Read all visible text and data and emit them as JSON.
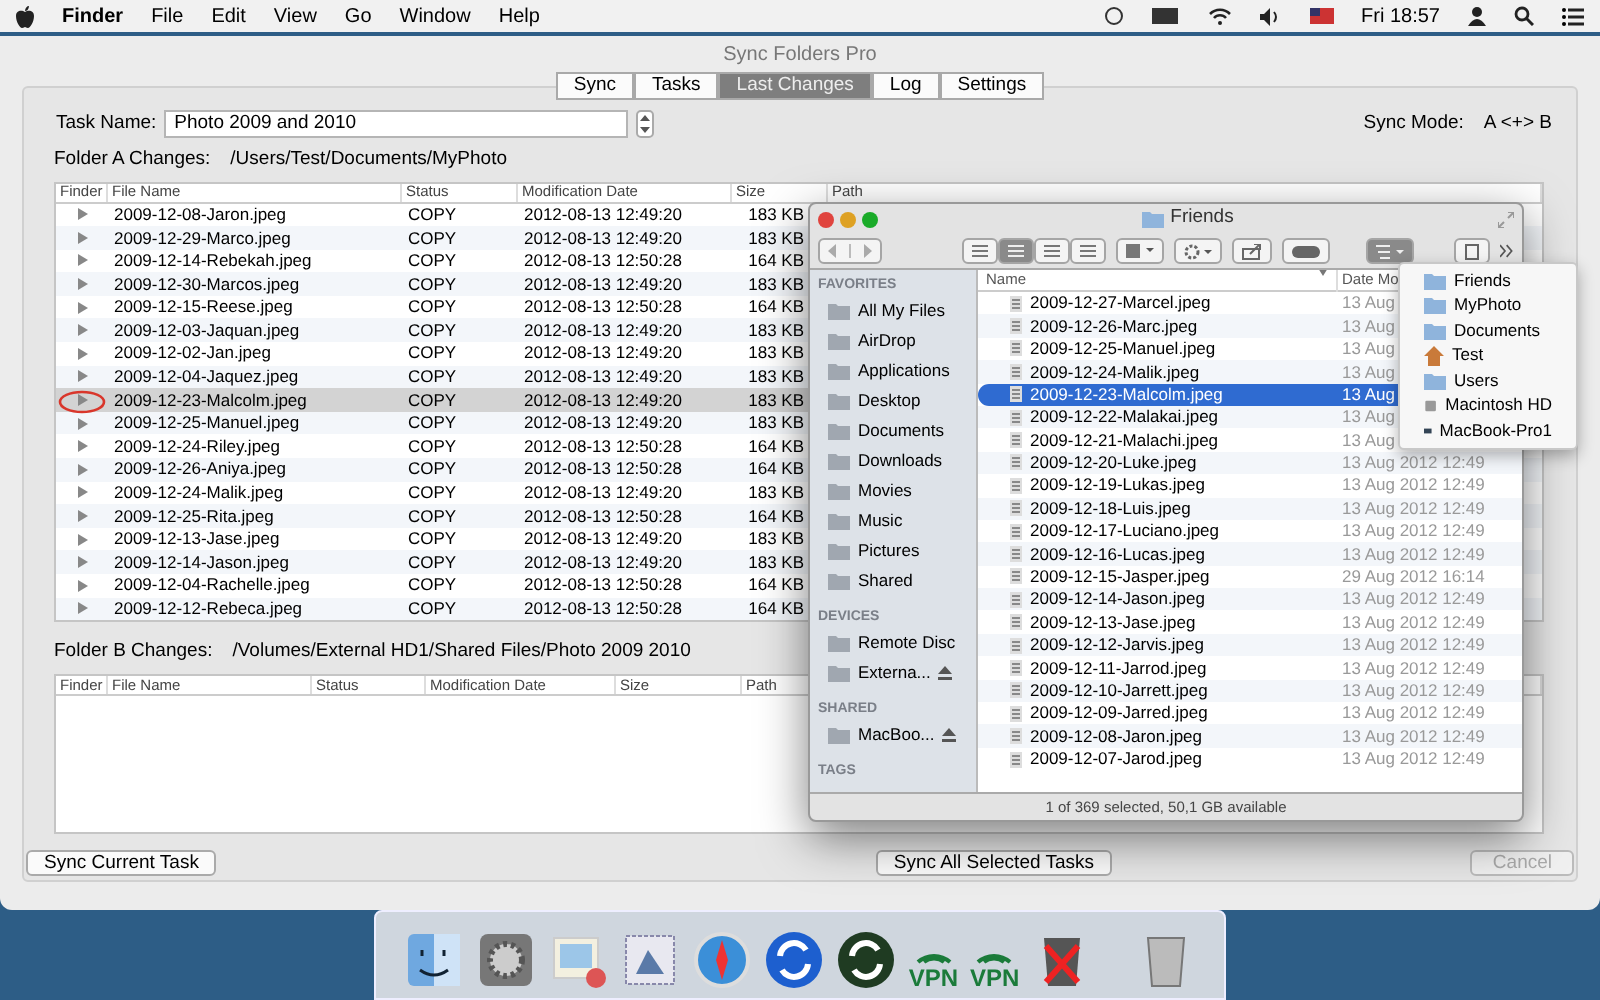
{
  "menu_bar": {
    "app": "Finder",
    "menus": [
      "File",
      "Edit",
      "View",
      "Go",
      "Window",
      "Help"
    ],
    "clock": "Fri 18:57"
  },
  "window": {
    "title": "Sync Folders Pro",
    "tabs": [
      {
        "label": "Sync",
        "selected": false
      },
      {
        "label": "Tasks",
        "selected": false
      },
      {
        "label": "Last Changes",
        "selected": true
      },
      {
        "label": "Log",
        "selected": false
      },
      {
        "label": "Settings",
        "selected": false
      }
    ],
    "task_name": {
      "label": "Task Name:",
      "value": "Photo 2009 and 2010"
    },
    "sync_mode": {
      "label": "Sync Mode:",
      "value": "A <+> B"
    },
    "folder_a": {
      "label": "Folder A Changes:",
      "path": "/Users/Test/Documents/MyPhoto",
      "columns": [
        "Finder",
        "File Name",
        "Status",
        "Modification Date",
        "Size",
        "Path"
      ],
      "rows": [
        {
          "name": "2009-12-08-Jaron.jpeg",
          "status": "COPY",
          "date": "2012-08-13 12:49:20",
          "size": "183 KB",
          "selected": false
        },
        {
          "name": "2009-12-29-Marco.jpeg",
          "status": "COPY",
          "date": "2012-08-13 12:49:20",
          "size": "183 KB",
          "selected": false
        },
        {
          "name": "2009-12-14-Rebekah.jpeg",
          "status": "COPY",
          "date": "2012-08-13 12:50:28",
          "size": "164 KB",
          "selected": false
        },
        {
          "name": "2009-12-30-Marcos.jpeg",
          "status": "COPY",
          "date": "2012-08-13 12:49:20",
          "size": "183 KB",
          "selected": false
        },
        {
          "name": "2009-12-15-Reese.jpeg",
          "status": "COPY",
          "date": "2012-08-13 12:50:28",
          "size": "164 KB",
          "selected": false
        },
        {
          "name": "2009-12-03-Jaquan.jpeg",
          "status": "COPY",
          "date": "2012-08-13 12:49:20",
          "size": "183 KB",
          "selected": false
        },
        {
          "name": "2009-12-02-Jan.jpeg",
          "status": "COPY",
          "date": "2012-08-13 12:49:20",
          "size": "183 KB",
          "selected": false
        },
        {
          "name": "2009-12-04-Jaquez.jpeg",
          "status": "COPY",
          "date": "2012-08-13 12:49:20",
          "size": "183 KB",
          "selected": false
        },
        {
          "name": "2009-12-23-Malcolm.jpeg",
          "status": "COPY",
          "date": "2012-08-13 12:49:20",
          "size": "183 KB",
          "selected": true
        },
        {
          "name": "2009-12-25-Manuel.jpeg",
          "status": "COPY",
          "date": "2012-08-13 12:49:20",
          "size": "183 KB",
          "selected": false
        },
        {
          "name": "2009-12-24-Riley.jpeg",
          "status": "COPY",
          "date": "2012-08-13 12:50:28",
          "size": "164 KB",
          "selected": false
        },
        {
          "name": "2009-12-26-Aniya.jpeg",
          "status": "COPY",
          "date": "2012-08-13 12:50:28",
          "size": "164 KB",
          "selected": false
        },
        {
          "name": "2009-12-24-Malik.jpeg",
          "status": "COPY",
          "date": "2012-08-13 12:49:20",
          "size": "183 KB",
          "selected": false
        },
        {
          "name": "2009-12-25-Rita.jpeg",
          "status": "COPY",
          "date": "2012-08-13 12:50:28",
          "size": "164 KB",
          "selected": false
        },
        {
          "name": "2009-12-13-Jase.jpeg",
          "status": "COPY",
          "date": "2012-08-13 12:49:20",
          "size": "183 KB",
          "selected": false
        },
        {
          "name": "2009-12-14-Jason.jpeg",
          "status": "COPY",
          "date": "2012-08-13 12:49:20",
          "size": "183 KB",
          "selected": false
        },
        {
          "name": "2009-12-04-Rachelle.jpeg",
          "status": "COPY",
          "date": "2012-08-13 12:50:28",
          "size": "164 KB",
          "selected": false
        },
        {
          "name": "2009-12-12-Rebeca.jpeg",
          "status": "COPY",
          "date": "2012-08-13 12:50:28",
          "size": "164 KB",
          "selected": false
        }
      ]
    },
    "folder_b": {
      "label": "Folder B Changes:",
      "path": "/Volumes/External HD1/Shared Files/Photo 2009 2010",
      "columns": [
        "Finder",
        "File Name",
        "Status",
        "Modification Date",
        "Size",
        "Path"
      ]
    },
    "buttons": {
      "sync_current": "Sync Current Task",
      "sync_all": "Sync All Selected Tasks",
      "cancel": {
        "label": "Cancel",
        "disabled": true
      }
    }
  },
  "finder": {
    "title": "Friends",
    "sidebar": [
      {
        "heading": "FAVORITES",
        "items": [
          {
            "label": "All My Files",
            "eject": false
          },
          {
            "label": "AirDrop",
            "eject": false
          },
          {
            "label": "Applications",
            "eject": false
          },
          {
            "label": "Desktop",
            "eject": false
          },
          {
            "label": "Documents",
            "eject": false
          },
          {
            "label": "Downloads",
            "eject": false
          },
          {
            "label": "Movies",
            "eject": false
          },
          {
            "label": "Music",
            "eject": false
          },
          {
            "label": "Pictures",
            "eject": false
          },
          {
            "label": "Shared",
            "eject": false
          }
        ]
      },
      {
        "heading": "DEVICES",
        "items": [
          {
            "label": "Remote Disc",
            "eject": false
          },
          {
            "label": "Externa...",
            "eject": true
          }
        ]
      },
      {
        "heading": "SHARED",
        "items": [
          {
            "label": "MacBoo...",
            "eject": true
          }
        ]
      },
      {
        "heading": "TAGS"
      }
    ],
    "columns": [
      "Name",
      "Date Mo"
    ],
    "files": [
      {
        "name": "2009-12-27-Marcel.jpeg",
        "date": "13 Aug",
        "selected": false
      },
      {
        "name": "2009-12-26-Marc.jpeg",
        "date": "13 Aug",
        "selected": false
      },
      {
        "name": "2009-12-25-Manuel.jpeg",
        "date": "13 Aug",
        "selected": false
      },
      {
        "name": "2009-12-24-Malik.jpeg",
        "date": "13 Aug",
        "selected": false
      },
      {
        "name": "2009-12-23-Malcolm.jpeg",
        "date": "13 Aug",
        "selected": true
      },
      {
        "name": "2009-12-22-Malakai.jpeg",
        "date": "13 Aug",
        "selected": false
      },
      {
        "name": "2009-12-21-Malachi.jpeg",
        "date": "13 Aug",
        "selected": false
      },
      {
        "name": "2009-12-20-Luke.jpeg",
        "date": "13 Aug 2012 12:49",
        "selected": false
      },
      {
        "name": "2009-12-19-Lukas.jpeg",
        "date": "13 Aug 2012 12:49",
        "selected": false
      },
      {
        "name": "2009-12-18-Luis.jpeg",
        "date": "13 Aug 2012 12:49",
        "selected": false
      },
      {
        "name": "2009-12-17-Luciano.jpeg",
        "date": "13 Aug 2012 12:49",
        "selected": false
      },
      {
        "name": "2009-12-16-Lucas.jpeg",
        "date": "13 Aug 2012 12:49",
        "selected": false
      },
      {
        "name": "2009-12-15-Jasper.jpeg",
        "date": "29 Aug 2012 16:14",
        "selected": false
      },
      {
        "name": "2009-12-14-Jason.jpeg",
        "date": "13 Aug 2012 12:49",
        "selected": false
      },
      {
        "name": "2009-12-13-Jase.jpeg",
        "date": "13 Aug 2012 12:49",
        "selected": false
      },
      {
        "name": "2009-12-12-Jarvis.jpeg",
        "date": "13 Aug 2012 12:49",
        "selected": false
      },
      {
        "name": "2009-12-11-Jarrod.jpeg",
        "date": "13 Aug 2012 12:49",
        "selected": false
      },
      {
        "name": "2009-12-10-Jarrett.jpeg",
        "date": "13 Aug 2012 12:49",
        "selected": false
      },
      {
        "name": "2009-12-09-Jarred.jpeg",
        "date": "13 Aug 2012 12:49",
        "selected": false
      },
      {
        "name": "2009-12-08-Jaron.jpeg",
        "date": "13 Aug 2012 12:49",
        "selected": false
      },
      {
        "name": "2009-12-07-Jarod.jpeg",
        "date": "13 Aug 2012 12:49",
        "selected": false
      }
    ],
    "status": "1 of 369 selected, 50,1 GB available",
    "path_menu": [
      {
        "label": "Friends",
        "kind": "folder"
      },
      {
        "label": "MyPhoto",
        "kind": "folder"
      },
      {
        "label": "Documents",
        "kind": "folder"
      },
      {
        "label": "Test",
        "kind": "home"
      },
      {
        "label": "Users",
        "kind": "folder"
      },
      {
        "label": "Macintosh HD",
        "kind": "drive"
      },
      {
        "label": "MacBook-Pro1",
        "kind": "computer"
      }
    ]
  },
  "dock": [
    {
      "kind": "finder"
    },
    {
      "kind": "preferences"
    },
    {
      "kind": "preview"
    },
    {
      "kind": "mail"
    },
    {
      "kind": "safari"
    },
    {
      "kind": "sync-blue"
    },
    {
      "kind": "sync-green"
    },
    {
      "kind": "vpn",
      "label": "VPN"
    },
    {
      "kind": "vpn",
      "label": "VPN"
    },
    {
      "kind": "trash-x"
    },
    {
      "kind": "trash"
    }
  ]
}
